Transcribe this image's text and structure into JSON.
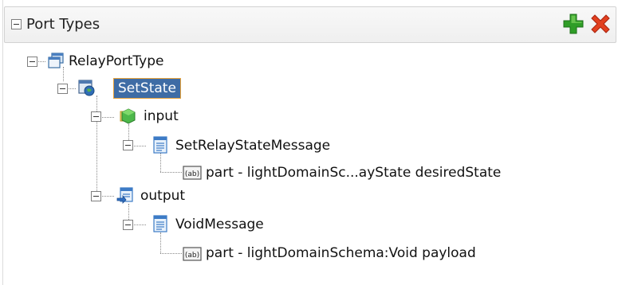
{
  "panel": {
    "title": "Port Types",
    "actions": {
      "add_icon": "plus-icon",
      "delete_icon": "x-icon"
    }
  },
  "tree": {
    "port_type": {
      "label": "RelayPortType"
    },
    "operation": {
      "label": "SetState",
      "selected": true
    },
    "input": {
      "label": "input"
    },
    "input_message": {
      "label": "SetRelayStateMessage"
    },
    "input_part": {
      "label": "part - lightDomainSc...ayState desiredState"
    },
    "output": {
      "label": "output"
    },
    "output_message": {
      "label": "VoidMessage"
    },
    "output_part": {
      "label": "part - lightDomainSchema:Void payload"
    }
  },
  "colors": {
    "selection_bg": "#3e6ca5",
    "selection_border": "#e8a23a",
    "add_green": "#33a02c",
    "delete_red": "#e03a1e"
  }
}
